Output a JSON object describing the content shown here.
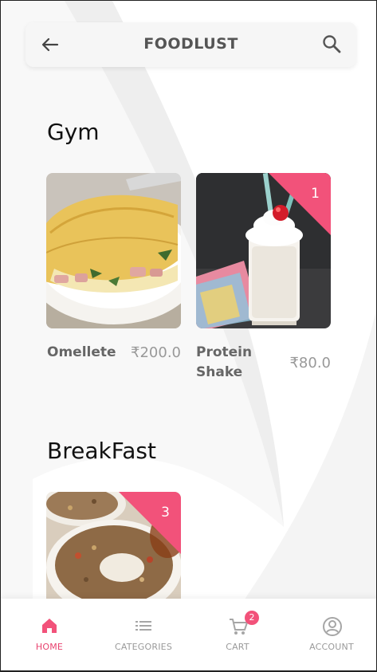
{
  "header": {
    "title": "FOODLUST"
  },
  "sections": [
    {
      "title": "Gym",
      "items": [
        {
          "name": "Omellete",
          "price": "₹200.0",
          "badge": ""
        },
        {
          "name": "Protein Shake",
          "name_line1": "Protein",
          "name_line2": "Shake",
          "price": "₹80.0",
          "badge": "1"
        }
      ]
    },
    {
      "title": "BreakFast",
      "items": [
        {
          "name": "",
          "price": "",
          "badge": "3"
        }
      ]
    }
  ],
  "nav": {
    "items": [
      {
        "label": "HOME",
        "icon": "home-icon",
        "active": true
      },
      {
        "label": "CATEGORIES",
        "icon": "list-icon",
        "active": false
      },
      {
        "label": "CART",
        "icon": "cart-icon",
        "active": false,
        "badge": "2"
      },
      {
        "label": "ACCOUNT",
        "icon": "account-icon",
        "active": false
      }
    ]
  },
  "colors": {
    "accent": "#f2527a",
    "active_nav": "#e8436f",
    "text_muted": "#999999"
  }
}
